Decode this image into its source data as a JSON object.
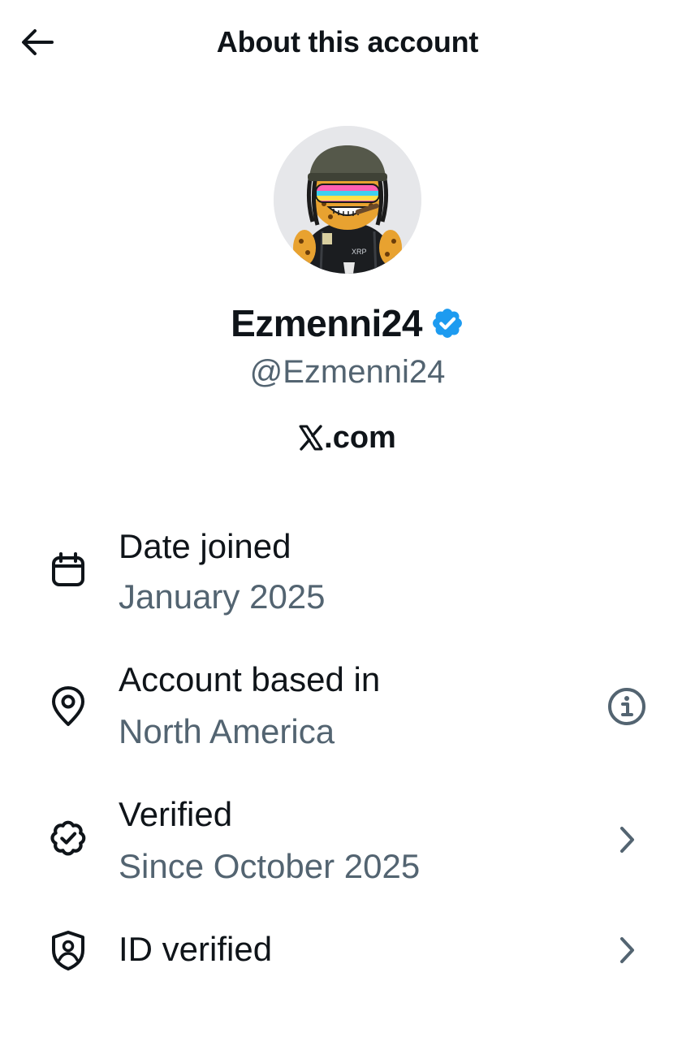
{
  "header": {
    "back_icon": "arrow-left-icon",
    "title": "About this account"
  },
  "profile": {
    "avatar_icon": "avatar-image",
    "display_name": "Ezmenni24",
    "verified_icon": "verified-badge-icon",
    "verified_color": "#1d9bf0",
    "handle": "@Ezmenni24",
    "site_text": ".com",
    "site_logo": "x-logo-icon"
  },
  "details": [
    {
      "icon": "calendar-icon",
      "title": "Date joined",
      "value": "January 2025"
    },
    {
      "icon": "location-pin-icon",
      "title": "Account based in",
      "value": "North America",
      "action_icon": "info-icon"
    },
    {
      "icon": "verified-seal-icon",
      "title": "Verified",
      "value": "Since October 2025",
      "action_icon": "chevron-right-icon"
    },
    {
      "icon": "id-shield-icon",
      "title": "ID verified",
      "action_icon": "chevron-right-icon"
    }
  ],
  "colors": {
    "primary_text": "#0f1419",
    "secondary_text": "#536471",
    "background": "#ffffff"
  }
}
